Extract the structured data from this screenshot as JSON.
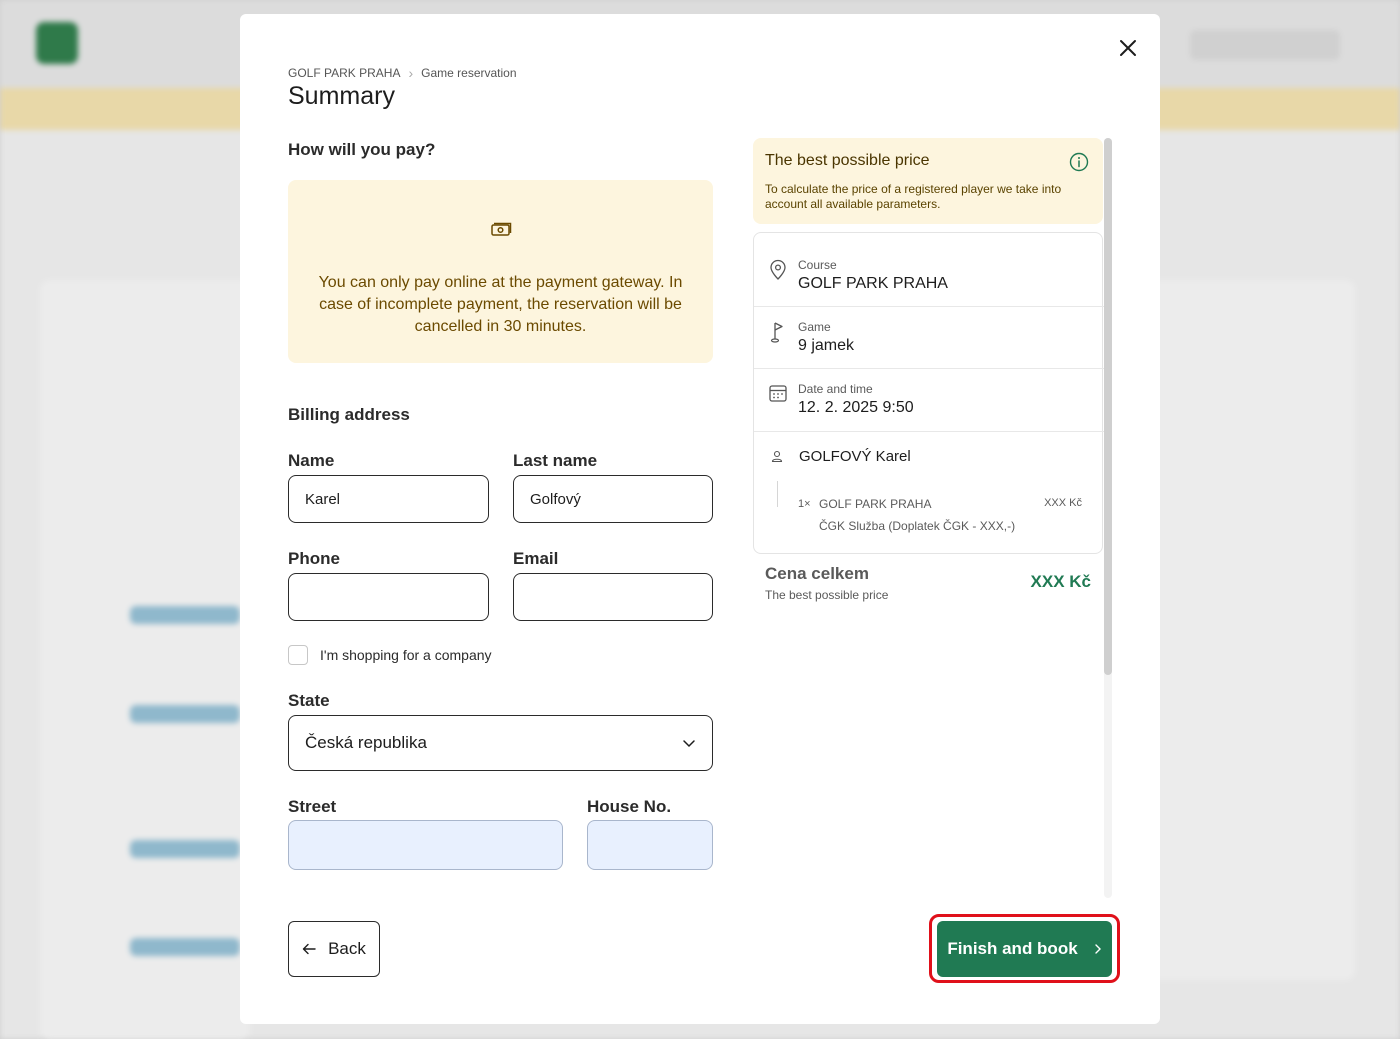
{
  "modal": {
    "breadcrumb": [
      "GOLF PARK PRAHA",
      "Game reservation"
    ],
    "title": "Summary",
    "payment": {
      "heading": "How will you pay?",
      "notice": "You can only pay online at the payment gateway. In case of incomplete payment, the reservation will be cancelled in 30 minutes."
    },
    "billing": {
      "heading": "Billing address",
      "name_label": "Name",
      "name_value": "Karel",
      "last_name_label": "Last name",
      "last_name_value": "Golfový",
      "phone_label": "Phone",
      "phone_value": "",
      "email_label": "Email",
      "email_value": "",
      "company_checkbox_label": "I'm shopping for a company",
      "state_label": "State",
      "state_value": "Česká republika",
      "street_label": "Street",
      "street_value": "",
      "house_label": "House No.",
      "house_value": ""
    },
    "buttons": {
      "back": "Back",
      "finish": "Finish and book"
    },
    "price_info": {
      "title": "The best possible price",
      "description": "To calculate the price of a registered player we take into account all available parameters."
    },
    "summary": {
      "course_label": "Course",
      "course_value": "GOLF PARK PRAHA",
      "game_label": "Game",
      "game_value": "9 jamek",
      "datetime_label": "Date and time",
      "datetime_value": "12. 2. 2025 9:50",
      "player_name": "GOLFOVÝ Karel",
      "item_qty": "1×",
      "item_name": "GOLF PARK PRAHA",
      "item_price": "XXX Kč",
      "item_sub": "ČGK Služba (Doplatek ČGK - XXX,-)"
    },
    "total": {
      "label": "Cena celkem",
      "sub": "The best possible price",
      "value": "XXX Kč"
    },
    "colors": {
      "accent_green": "#207a53",
      "notice_bg": "#fdf5de",
      "highlight_red": "#e0101a"
    }
  }
}
